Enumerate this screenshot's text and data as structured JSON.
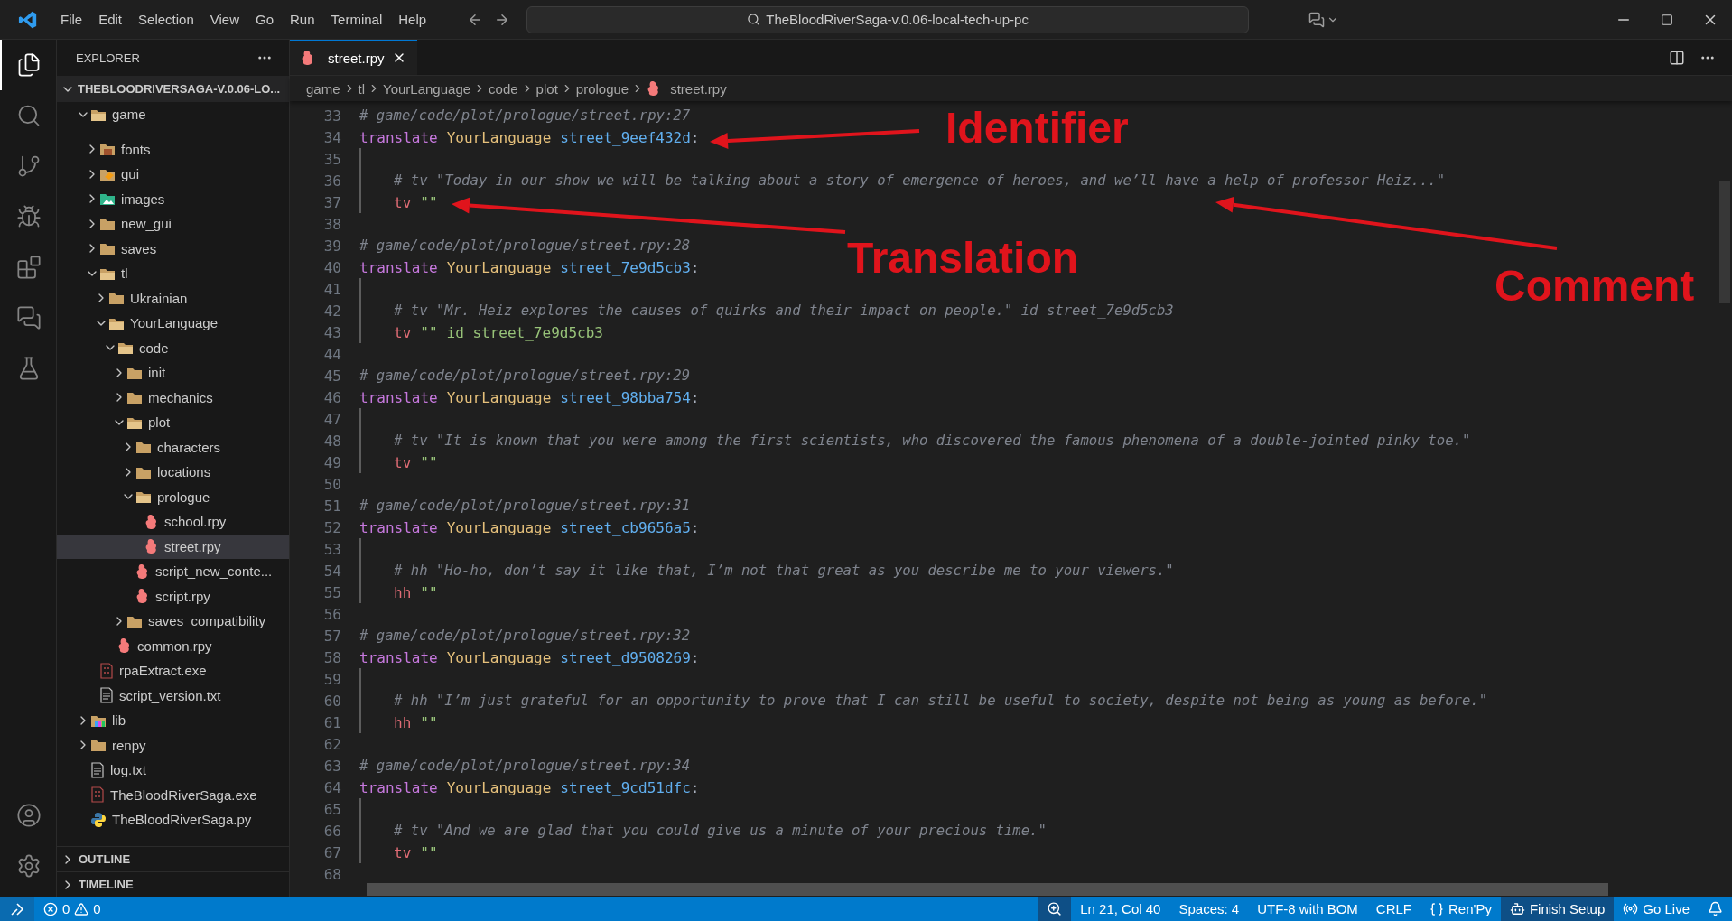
{
  "title_bar": {
    "menu": [
      "File",
      "Edit",
      "Selection",
      "View",
      "Go",
      "Run",
      "Terminal",
      "Help"
    ],
    "command_center": "TheBloodRiverSaga-v.0.06-local-tech-up-pc"
  },
  "activity_bar": [
    {
      "kind": "files",
      "selected": true
    },
    {
      "kind": "search",
      "selected": false
    },
    {
      "kind": "source-control",
      "selected": false
    },
    {
      "kind": "debug",
      "selected": false
    },
    {
      "kind": "extensions",
      "selected": false
    },
    {
      "kind": "chat",
      "selected": false
    },
    {
      "kind": "testing",
      "selected": false
    }
  ],
  "sidebar": {
    "title": "EXPLORER",
    "root": "THEBLOODRIVERSAGA-V.0.06-LO...",
    "items": [
      {
        "name": "game",
        "kind": "folder",
        "expanded": true,
        "selected": false,
        "children": [
          {
            "name": "fonts",
            "kind": "fonts-folder",
            "expanded": false,
            "selected": false
          },
          {
            "name": "gui",
            "kind": "gui-folder",
            "expanded": false,
            "selected": false
          },
          {
            "name": "images",
            "kind": "images-folder",
            "expanded": false,
            "selected": false
          },
          {
            "name": "new_gui",
            "kind": "folder",
            "expanded": false,
            "selected": false
          },
          {
            "name": "saves",
            "kind": "folder",
            "expanded": false,
            "selected": false
          },
          {
            "name": "tl",
            "kind": "folder",
            "expanded": true,
            "selected": false,
            "children": [
              {
                "name": "Ukrainian",
                "kind": "folder",
                "expanded": false,
                "selected": false
              },
              {
                "name": "YourLanguage",
                "kind": "folder",
                "expanded": true,
                "selected": false,
                "children": [
                  {
                    "name": "code",
                    "kind": "folder",
                    "expanded": true,
                    "selected": false,
                    "children": [
                      {
                        "name": "init",
                        "kind": "folder",
                        "expanded": false,
                        "selected": false
                      },
                      {
                        "name": "mechanics",
                        "kind": "folder",
                        "expanded": false,
                        "selected": false
                      },
                      {
                        "name": "plot",
                        "kind": "folder",
                        "expanded": true,
                        "selected": false,
                        "children": [
                          {
                            "name": "characters",
                            "kind": "folder",
                            "expanded": false,
                            "selected": false
                          },
                          {
                            "name": "locations",
                            "kind": "folder",
                            "expanded": false,
                            "selected": false
                          },
                          {
                            "name": "prologue",
                            "kind": "folder",
                            "expanded": true,
                            "selected": false,
                            "children": [
                              {
                                "name": "school.rpy",
                                "kind": "rpy",
                                "selected": false
                              },
                              {
                                "name": "street.rpy",
                                "kind": "rpy",
                                "selected": true
                              }
                            ]
                          },
                          {
                            "name": "script_new_conte...",
                            "kind": "rpy",
                            "selected": false
                          },
                          {
                            "name": "script.rpy",
                            "kind": "rpy",
                            "selected": false
                          }
                        ]
                      },
                      {
                        "name": "saves_compatibility",
                        "kind": "folder",
                        "expanded": false,
                        "selected": false
                      }
                    ]
                  },
                  {
                    "name": "common.rpy",
                    "kind": "rpy",
                    "selected": false
                  }
                ]
              }
            ]
          },
          {
            "name": "rpaExtract.exe",
            "kind": "exe",
            "selected": false
          },
          {
            "name": "script_version.txt",
            "kind": "txt",
            "selected": false
          }
        ]
      },
      {
        "name": "lib",
        "kind": "lib-folder",
        "expanded": false,
        "selected": false
      },
      {
        "name": "renpy",
        "kind": "folder",
        "expanded": false,
        "selected": false
      },
      {
        "name": "log.txt",
        "kind": "txt",
        "selected": false
      },
      {
        "name": "TheBloodRiverSaga.exe",
        "kind": "exe",
        "selected": false
      },
      {
        "name": "TheBloodRiverSaga.py",
        "kind": "py",
        "selected": false
      }
    ]
  },
  "panels": [
    {
      "title": "OUTLINE",
      "expanded": false
    },
    {
      "title": "TIMELINE",
      "expanded": false
    }
  ],
  "tabs": [
    {
      "label": "street.rpy",
      "selected": true
    }
  ],
  "breadcrumbs": [
    "game",
    "tl",
    "YourLanguage",
    "code",
    "plot",
    "prologue",
    "street.rpy"
  ],
  "code_lines": [
    {
      "number": "33",
      "indented": false,
      "tokens": [
        {
          "kind": "comment",
          "text": "# game/code/plot/prologue/street.rpy:27"
        }
      ]
    },
    {
      "number": "34",
      "indented": false,
      "tokens": [
        {
          "kind": "keyword",
          "text": "translate"
        },
        {
          "kind": "language",
          "text": "YourLanguage"
        },
        {
          "kind": "identifier",
          "text": "street_9eef432d"
        },
        {
          "kind": "punct",
          "text": ":"
        }
      ]
    },
    {
      "number": "35",
      "indented": true
    },
    {
      "number": "36",
      "indented": true,
      "tokens": [
        {
          "kind": "comment",
          "text": "# tv \"Today in our show we will be talking about a story of emergence of heroes, and we’ll have a help of professor Heiz...\""
        }
      ]
    },
    {
      "number": "37",
      "indented": true,
      "tokens": [
        {
          "kind": "character",
          "text": "tv"
        },
        {
          "kind": "string",
          "text": "\"\""
        }
      ]
    },
    {
      "number": "38",
      "indented": false
    },
    {
      "number": "39",
      "indented": false,
      "tokens": [
        {
          "kind": "comment",
          "text": "# game/code/plot/prologue/street.rpy:28"
        }
      ]
    },
    {
      "number": "40",
      "indented": false,
      "tokens": [
        {
          "kind": "keyword",
          "text": "translate"
        },
        {
          "kind": "language",
          "text": "YourLanguage"
        },
        {
          "kind": "identifier",
          "text": "street_7e9d5cb3"
        },
        {
          "kind": "punct",
          "text": ":"
        }
      ]
    },
    {
      "number": "41",
      "indented": true
    },
    {
      "number": "42",
      "indented": true,
      "tokens": [
        {
          "kind": "comment",
          "text": "# tv \"Mr. Heiz explores the causes of quirks and their impact on people.\" id street_7e9d5cb3"
        }
      ]
    },
    {
      "number": "43",
      "indented": true,
      "tokens": [
        {
          "kind": "character",
          "text": "tv"
        },
        {
          "kind": "string",
          "text": "\"\""
        },
        {
          "kind": "name",
          "text": "id street_7e9d5cb3"
        }
      ]
    },
    {
      "number": "44",
      "indented": false
    },
    {
      "number": "45",
      "indented": false,
      "tokens": [
        {
          "kind": "comment",
          "text": "# game/code/plot/prologue/street.rpy:29"
        }
      ]
    },
    {
      "number": "46",
      "indented": false,
      "tokens": [
        {
          "kind": "keyword",
          "text": "translate"
        },
        {
          "kind": "language",
          "text": "YourLanguage"
        },
        {
          "kind": "identifier",
          "text": "street_98bba754"
        },
        {
          "kind": "punct",
          "text": ":"
        }
      ]
    },
    {
      "number": "47",
      "indented": true
    },
    {
      "number": "48",
      "indented": true,
      "tokens": [
        {
          "kind": "comment",
          "text": "# tv \"It is known that you were among the first scientists, who discovered the famous phenomena of a double-jointed pinky toe.\""
        }
      ]
    },
    {
      "number": "49",
      "indented": true,
      "tokens": [
        {
          "kind": "character",
          "text": "tv"
        },
        {
          "kind": "string",
          "text": "\"\""
        }
      ]
    },
    {
      "number": "50",
      "indented": false
    },
    {
      "number": "51",
      "indented": false,
      "tokens": [
        {
          "kind": "comment",
          "text": "# game/code/plot/prologue/street.rpy:31"
        }
      ]
    },
    {
      "number": "52",
      "indented": false,
      "tokens": [
        {
          "kind": "keyword",
          "text": "translate"
        },
        {
          "kind": "language",
          "text": "YourLanguage"
        },
        {
          "kind": "identifier",
          "text": "street_cb9656a5"
        },
        {
          "kind": "punct",
          "text": ":"
        }
      ]
    },
    {
      "number": "53",
      "indented": true
    },
    {
      "number": "54",
      "indented": true,
      "tokens": [
        {
          "kind": "comment",
          "text": "# hh \"Ho-ho, don’t say it like that, I’m not that great as you describe me to your viewers.\""
        }
      ]
    },
    {
      "number": "55",
      "indented": true,
      "tokens": [
        {
          "kind": "character",
          "text": "hh"
        },
        {
          "kind": "string",
          "text": "\"\""
        }
      ]
    },
    {
      "number": "56",
      "indented": false
    },
    {
      "number": "57",
      "indented": false,
      "tokens": [
        {
          "kind": "comment",
          "text": "# game/code/plot/prologue/street.rpy:32"
        }
      ]
    },
    {
      "number": "58",
      "indented": false,
      "tokens": [
        {
          "kind": "keyword",
          "text": "translate"
        },
        {
          "kind": "language",
          "text": "YourLanguage"
        },
        {
          "kind": "identifier",
          "text": "street_d9508269"
        },
        {
          "kind": "punct",
          "text": ":"
        }
      ]
    },
    {
      "number": "59",
      "indented": true
    },
    {
      "number": "60",
      "indented": true,
      "tokens": [
        {
          "kind": "comment",
          "text": "# hh \"I’m just grateful for an opportunity to prove that I can still be useful to society, despite not being as young as before.\""
        }
      ]
    },
    {
      "number": "61",
      "indented": true,
      "tokens": [
        {
          "kind": "character",
          "text": "hh"
        },
        {
          "kind": "string",
          "text": "\"\""
        }
      ]
    },
    {
      "number": "62",
      "indented": false
    },
    {
      "number": "63",
      "indented": false,
      "tokens": [
        {
          "kind": "comment",
          "text": "# game/code/plot/prologue/street.rpy:34"
        }
      ]
    },
    {
      "number": "64",
      "indented": false,
      "tokens": [
        {
          "kind": "keyword",
          "text": "translate"
        },
        {
          "kind": "language",
          "text": "YourLanguage"
        },
        {
          "kind": "identifier",
          "text": "street_9cd51dfc"
        },
        {
          "kind": "punct",
          "text": ":"
        }
      ]
    },
    {
      "number": "65",
      "indented": true
    },
    {
      "number": "66",
      "indented": true,
      "tokens": [
        {
          "kind": "comment",
          "text": "# tv \"And we are glad that you could give us a minute of your precious time.\""
        }
      ]
    },
    {
      "number": "67",
      "indented": true,
      "tokens": [
        {
          "kind": "character",
          "text": "tv"
        },
        {
          "kind": "string",
          "text": "\"\""
        }
      ]
    },
    {
      "number": "68",
      "indented": false
    }
  ],
  "annotations": [
    {
      "label": "Identifier"
    },
    {
      "label": "Translation"
    },
    {
      "label": "Comment"
    }
  ],
  "status_bar": {
    "errors": "0",
    "warnings": "0",
    "items": [
      {
        "kind": "text",
        "text": "Ln 21, Col 40"
      },
      {
        "kind": "text",
        "text": "Spaces: 4"
      },
      {
        "kind": "text",
        "text": "UTF-8 with BOM"
      },
      {
        "kind": "text",
        "text": "CRLF"
      },
      {
        "kind": "language",
        "text": "Ren'Py"
      },
      {
        "kind": "copilot",
        "text": "Finish Setup"
      },
      {
        "kind": "live",
        "text": "Go Live"
      }
    ]
  }
}
